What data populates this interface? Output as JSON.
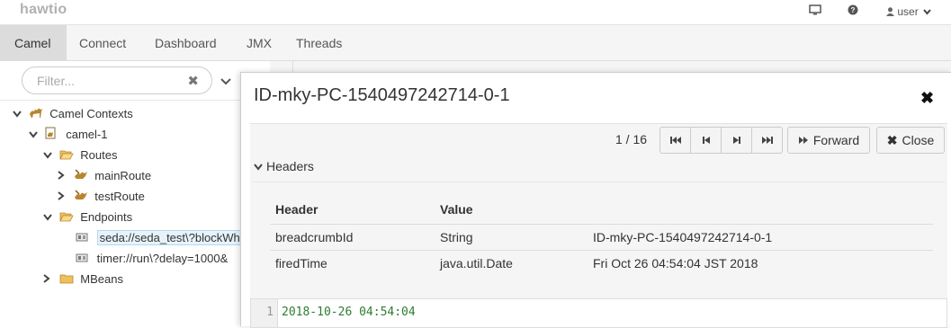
{
  "brand": "hawtio",
  "user_menu": {
    "label": "user"
  },
  "nav": {
    "tabs": [
      {
        "label": "Camel"
      },
      {
        "label": "Connect"
      },
      {
        "label": "Dashboard"
      },
      {
        "label": "JMX"
      },
      {
        "label": "Threads"
      }
    ]
  },
  "tree": {
    "filter_placeholder": "Filter...",
    "nodes": [
      {
        "label": "Camel Contexts"
      },
      {
        "label": "camel-1"
      },
      {
        "label": "Routes"
      },
      {
        "label": "mainRoute"
      },
      {
        "label": "testRoute"
      },
      {
        "label": "Endpoints"
      },
      {
        "label": "seda://seda_test\\?blockWh"
      },
      {
        "label": "timer://run\\?delay=1000&"
      },
      {
        "label": "MBeans"
      }
    ]
  },
  "modal": {
    "title": "ID-mky-PC-1540497242714-0-1",
    "pager": "1 / 16",
    "forward_label": "Forward",
    "close_label": "Close",
    "section_label": "Headers",
    "headers_table": {
      "columns": [
        "Header",
        "Value",
        ""
      ],
      "rows": [
        [
          "breadcrumbId",
          "String",
          "ID-mky-PC-1540497242714-0-1"
        ],
        [
          "firedTime",
          "java.util.Date",
          "Fri Oct 26 04:54:04 JST 2018"
        ]
      ]
    },
    "body": {
      "line_number": "1",
      "text": "2018-10-26 04:54:04"
    }
  }
}
